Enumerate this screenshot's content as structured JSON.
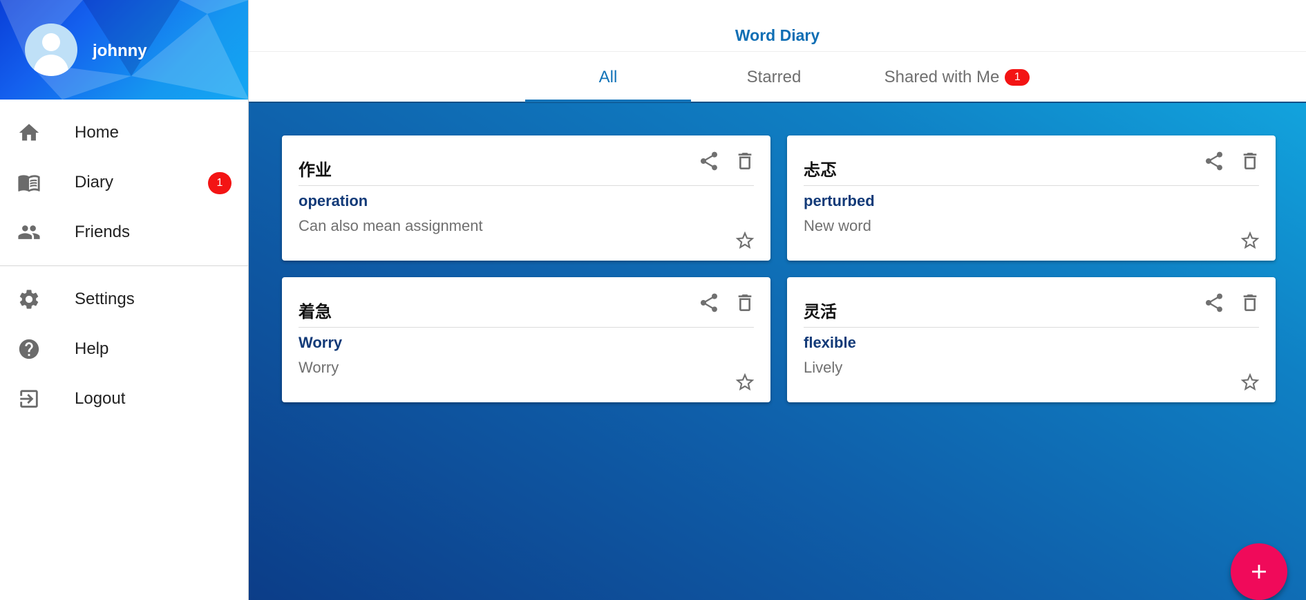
{
  "profile": {
    "username": "johnny",
    "avatar_icon": "person-icon"
  },
  "nav": {
    "items": [
      {
        "label": "Home",
        "icon": "home-icon"
      },
      {
        "label": "Diary",
        "icon": "book-icon",
        "badge": "1"
      },
      {
        "label": "Friends",
        "icon": "people-icon"
      },
      {
        "label": "Settings",
        "icon": "gear-icon"
      },
      {
        "label": "Help",
        "icon": "help-icon"
      },
      {
        "label": "Logout",
        "icon": "logout-icon"
      }
    ]
  },
  "header": {
    "title": "Word Diary",
    "tabs": [
      {
        "label": "All",
        "active": true
      },
      {
        "label": "Starred",
        "active": false
      },
      {
        "label": "Shared with Me",
        "active": false,
        "badge": "1"
      }
    ]
  },
  "cards": [
    {
      "title": "作业",
      "word": "operation",
      "note": "Can also mean assignment"
    },
    {
      "title": "忐忑",
      "word": "perturbed",
      "note": "New word"
    },
    {
      "title": "着急",
      "word": "Worry",
      "note": "Worry"
    },
    {
      "title": "灵活",
      "word": "flexible",
      "note": "Lively"
    }
  ],
  "colors": {
    "accent": "#1273b8",
    "badge": "#f31414",
    "fab": "#f00a5a",
    "word": "#123a78"
  },
  "fab": {
    "icon": "plus-icon"
  }
}
